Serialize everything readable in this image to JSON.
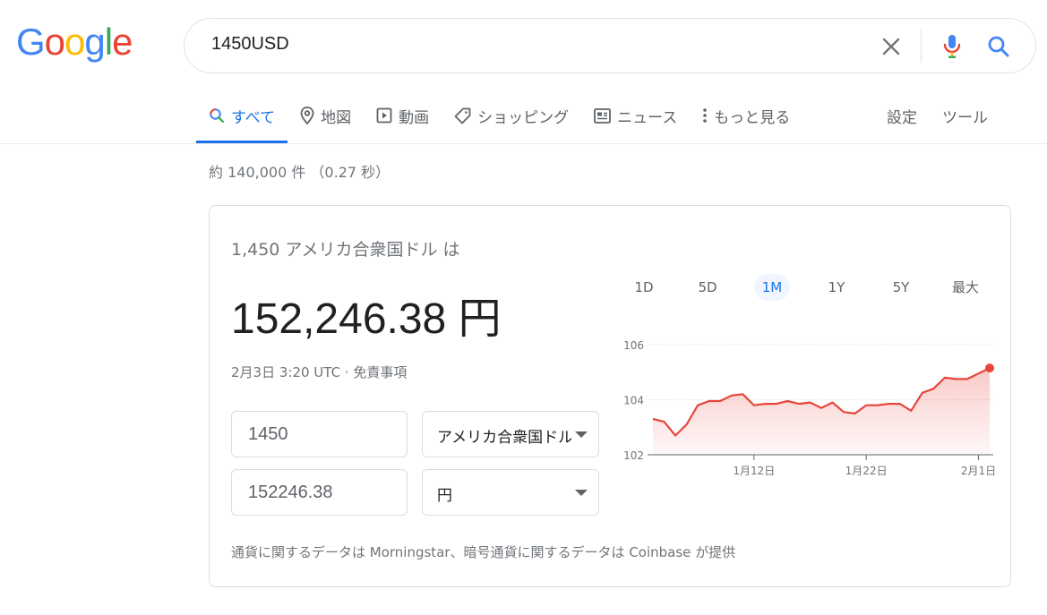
{
  "logo": {
    "text": "Google",
    "colors": [
      "#4285f4",
      "#ea4335",
      "#fbbc05",
      "#4285f4",
      "#34a853",
      "#ea4335"
    ]
  },
  "search": {
    "query": "1450USD",
    "clear_icon": "close-icon",
    "mic_icon": "mic-icon",
    "search_icon": "search-icon"
  },
  "tabs": [
    {
      "label": "すべて",
      "icon": "search-icon",
      "active": true
    },
    {
      "label": "地図",
      "icon": "map-pin-icon"
    },
    {
      "label": "動画",
      "icon": "video-icon"
    },
    {
      "label": "ショッピング",
      "icon": "tag-icon"
    },
    {
      "label": "ニュース",
      "icon": "news-icon"
    },
    {
      "label": "もっと見る",
      "icon": "more-vert-icon"
    }
  ],
  "tools": {
    "settings": "設定",
    "tools": "ツール"
  },
  "stats": "約 140,000 件 （0.27 秒）",
  "converter": {
    "label": "1,450 アメリカ合衆国ドル は",
    "result": "152,246.38 円",
    "timestamp": "2月3日 3:20 UTC · ",
    "disclaimer": "免責事項",
    "from_amount": "1450",
    "from_currency": "アメリカ合衆国ドル",
    "to_amount": "152246.38",
    "to_currency": "円",
    "footnote": "通貨に関するデータは Morningstar、暗号通貨に関するデータは Coinbase が提供"
  },
  "ranges": [
    "1D",
    "5D",
    "1M",
    "1Y",
    "5Y",
    "最大"
  ],
  "active_range": "1M",
  "colors": {
    "accent": "#1a73e8",
    "line": "#e8453c"
  },
  "chart_data": {
    "type": "area",
    "ylim": [
      102,
      106
    ],
    "y_ticks": [
      "102",
      "104",
      "106"
    ],
    "x_ticks": [
      {
        "label": "1月12日",
        "x": 9
      },
      {
        "label": "1月22日",
        "x": 19
      },
      {
        "label": "2月1日",
        "x": 29
      }
    ],
    "x": [
      0,
      1,
      2,
      3,
      4,
      5,
      6,
      7,
      8,
      9,
      10,
      11,
      12,
      13,
      14,
      15,
      16,
      17,
      18,
      19,
      20,
      21,
      22,
      23,
      24,
      25,
      26,
      27,
      28,
      29,
      30
    ],
    "values": [
      103.3,
      103.2,
      102.7,
      103.1,
      103.8,
      103.95,
      103.95,
      104.15,
      104.2,
      103.8,
      103.85,
      103.85,
      103.95,
      103.85,
      103.9,
      103.7,
      103.9,
      103.55,
      103.5,
      103.8,
      103.8,
      103.85,
      103.85,
      103.6,
      104.25,
      104.4,
      104.8,
      104.75,
      104.75,
      104.95,
      105.15
    ],
    "grid": true
  }
}
